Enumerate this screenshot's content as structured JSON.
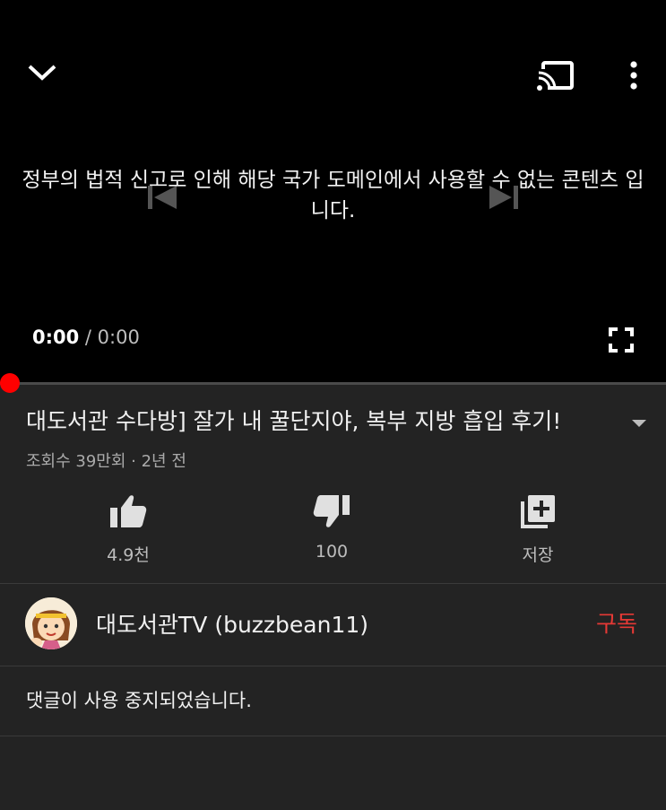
{
  "player": {
    "message": "정부의 법적 신고로 인해 해당 국가 도메인에서 사용할 수 없는 콘텐츠 입니다.",
    "current_time": "0:00",
    "separator": " / ",
    "duration": "0:00",
    "progress": 0
  },
  "video": {
    "title": "대도서관 수다방] 잘가 내 꿀단지야, 복부 지방 흡입 후기!",
    "meta": "조회수 39만회 · 2년 전"
  },
  "actions": {
    "like": "4.9천",
    "dislike": "100",
    "save": "저장"
  },
  "channel": {
    "name": "대도서관TV (buzzbean11)",
    "subscribe": "구독"
  },
  "comments": {
    "status": "댓글이 사용 중지되었습니다."
  },
  "colors": {
    "accent": "#ff0000",
    "subscribe": "#e53935",
    "background": "#232323"
  }
}
